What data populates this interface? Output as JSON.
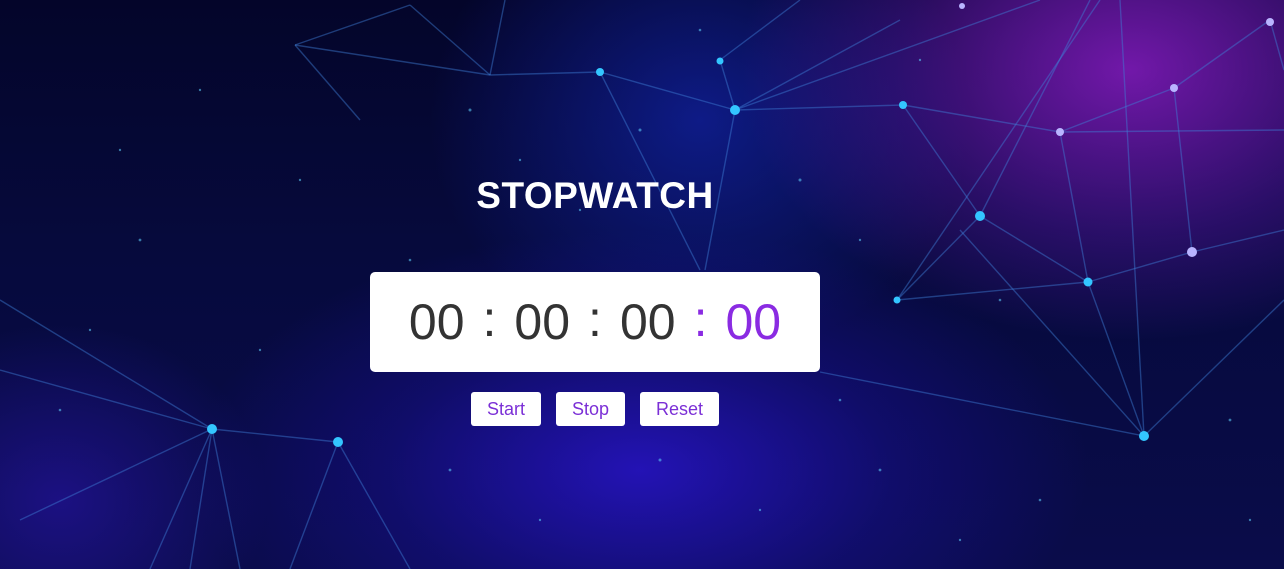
{
  "page": {
    "title": "STOPWATCH"
  },
  "timer": {
    "hours": "00",
    "minutes": "00",
    "seconds": "00",
    "milliseconds": "00",
    "separator": ":"
  },
  "controls": {
    "start_label": "Start",
    "stop_label": "Stop",
    "reset_label": "Reset"
  },
  "colors": {
    "accent": "#8a2be2",
    "display_bg": "#ffffff",
    "digits": "#333333"
  }
}
